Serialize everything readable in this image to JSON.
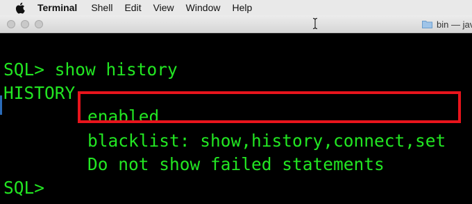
{
  "menubar": {
    "app_name": "Terminal",
    "items": [
      "Shell",
      "Edit",
      "View",
      "Window",
      "Help"
    ]
  },
  "titlebar": {
    "tab_title": "bin — jav"
  },
  "terminal": {
    "lines": [
      "SQL> show history",
      "HISTORY",
      "enabled",
      "blacklist: show,history,connect,set",
      "Do not show failed statements",
      "SQL>"
    ],
    "text_color": "#22e622",
    "highlight_color": "#e8141c"
  }
}
